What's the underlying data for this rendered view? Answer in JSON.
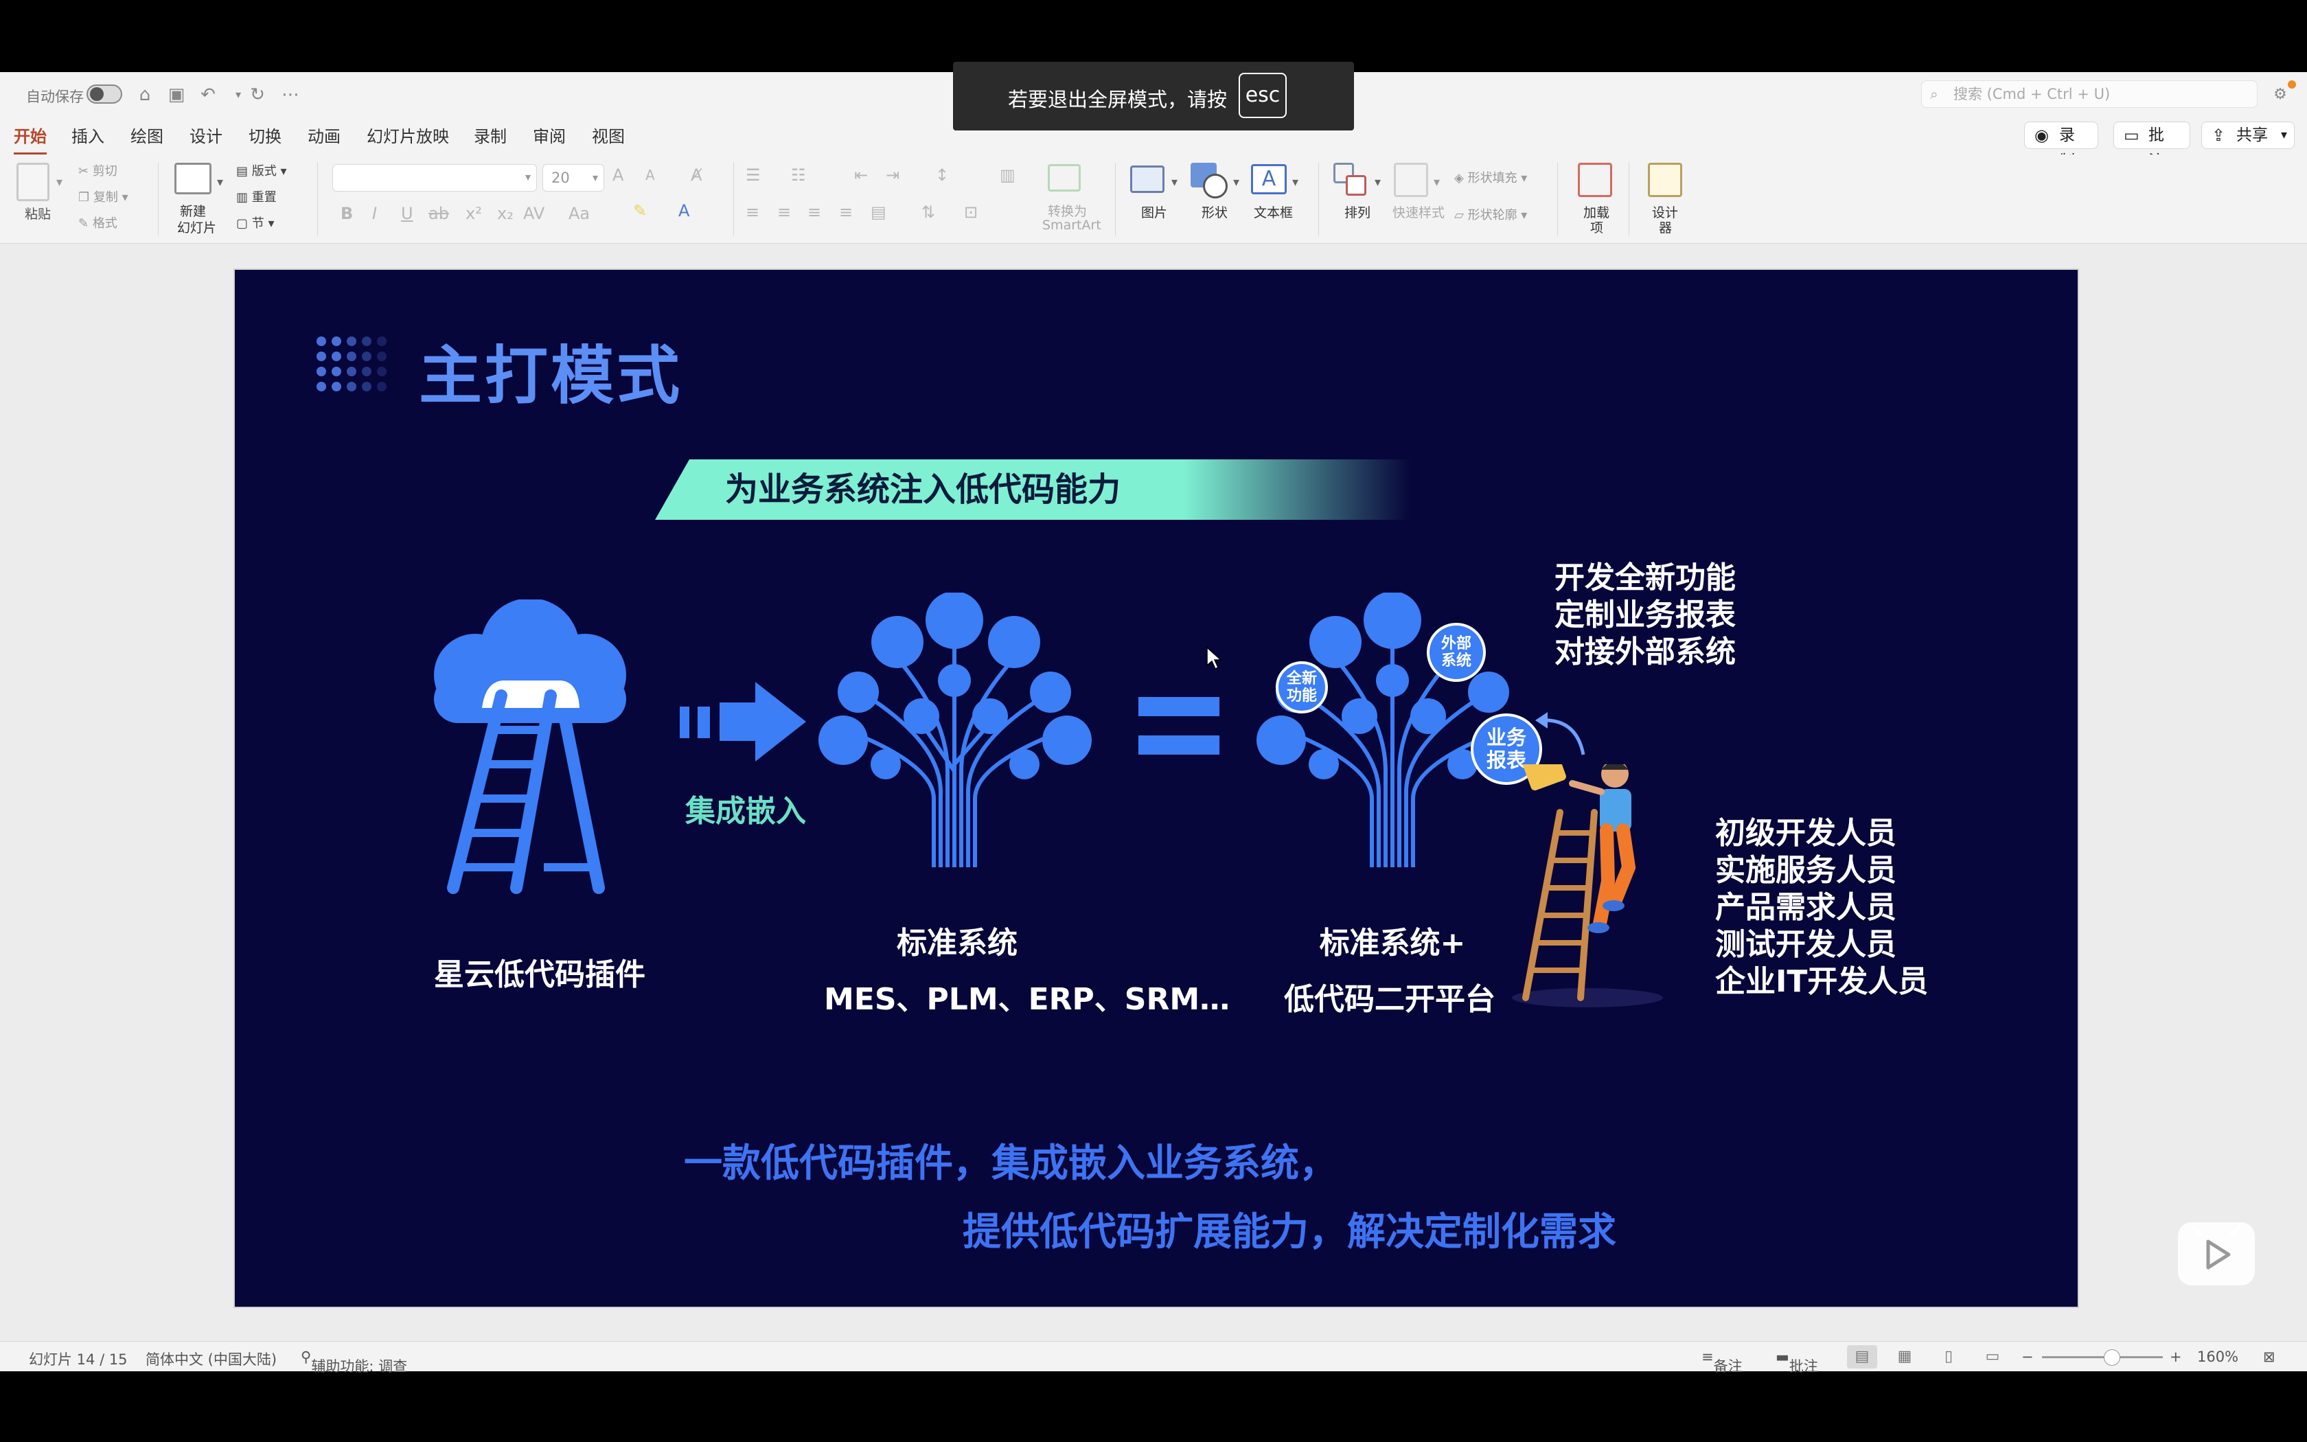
{
  "window": {
    "autosave_label": "自动保存",
    "search_placeholder": "搜索 (Cmd + Ctrl + U)"
  },
  "tabs": [
    "开始",
    "插入",
    "绘图",
    "设计",
    "切换",
    "动画",
    "幻灯片放映",
    "录制",
    "审阅",
    "视图"
  ],
  "tab_buttons": {
    "record": "录制",
    "comment": "批注",
    "share": "共享"
  },
  "ribbon": {
    "paste": "粘贴",
    "cut": "剪切",
    "copy": "复制",
    "format": "格式",
    "new_slide_l1": "新建",
    "new_slide_l2": "幻灯片",
    "layout": "版式",
    "reset": "重置",
    "section": "节",
    "font_size": "20",
    "convert_l1": "转换为",
    "convert_l2": "SmartArt",
    "picture": "图片",
    "shape": "形状",
    "textbox": "文本框",
    "arrange": "排列",
    "quick_styles": "快速样式",
    "shape_fill": "形状填充",
    "shape_outline": "形状轮廓",
    "addins_l1": "加载",
    "addins_l2": "项",
    "designer_l1": "设计",
    "designer_l2": "器"
  },
  "toast": {
    "message": "若要退出全屏模式，请按",
    "key": "esc"
  },
  "slide": {
    "title": "主打模式",
    "banner": "为业务系统注入低代码能力",
    "plugin_label": "星云低代码插件",
    "arrow_label": "集成嵌入",
    "standard_label": "标准系统",
    "standard_sub": "MES、PLM、ERP、SRM…",
    "plus_label": "标准系统+",
    "plus_sub": "低代码二开平台",
    "bubble_new": "全新\n功能",
    "bubble_ext": "外部\n系统",
    "bubble_report": "业务\n报表",
    "features": [
      "开发全新功能",
      "定制业务报表",
      "对接外部系统"
    ],
    "roles": [
      "初级开发人员",
      "实施服务人员",
      "产品需求人员",
      "测试开发人员",
      "企业IT开发人员"
    ],
    "bottom_line1": "一款低代码插件，集成嵌入业务系统，",
    "bottom_line2": "提供低代码扩展能力，解决定制化需求"
  },
  "status": {
    "slide_counter": "幻灯片 14 / 15",
    "language": "简体中文 (中国大陆)",
    "accessibility": "辅助功能: 调查",
    "notes": "备注",
    "comments": "批注",
    "zoom": "160%"
  },
  "colors": {
    "slide_bg": "#07063a",
    "accent_blue": "#3e73f2",
    "banner_green": "#7ff0d2",
    "active_tab": "#b6472b"
  }
}
